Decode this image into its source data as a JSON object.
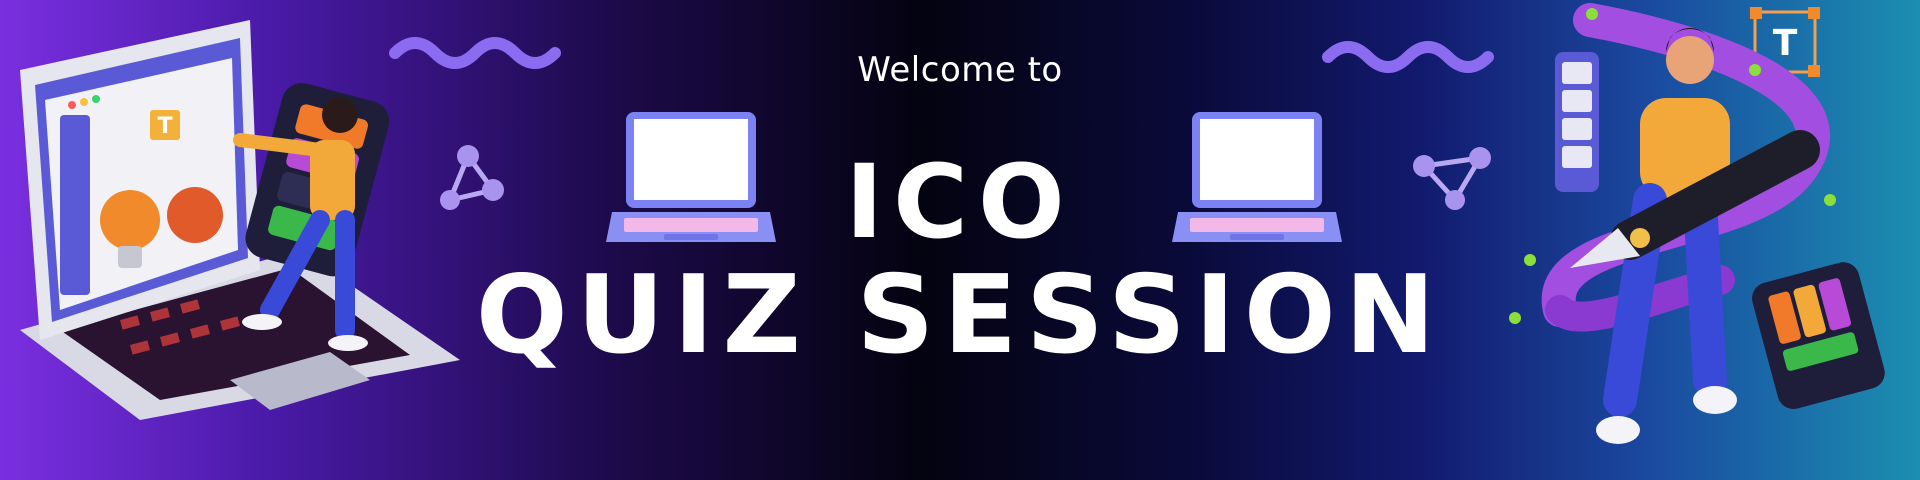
{
  "banner": {
    "welcome": "Welcome to",
    "title_line1": "ICO",
    "title_line2": "QUIZ SESSION"
  },
  "colors": {
    "background_left": "#7a2fe0",
    "background_center": "#040310",
    "background_right": "#1b8fb0",
    "accent_purple": "#8b6cf0",
    "laptop_screen": "#ffffff",
    "text": "#ffffff"
  },
  "icons": {
    "decorations": [
      "wavy-line-icon",
      "triangle-nodes-icon",
      "laptop-icon",
      "designer-laptop-illustration",
      "pen-tool-illustration"
    ],
    "tool_glyph": "T"
  }
}
